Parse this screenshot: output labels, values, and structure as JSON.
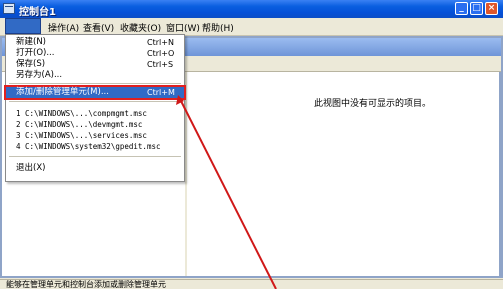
{
  "window": {
    "title": "控制台1",
    "buttons": {
      "minimize": "_",
      "maximize": "□",
      "close": "×"
    }
  },
  "menubar": {
    "items": [
      "操作(A)",
      "查看(V)",
      "收藏夹(O)",
      "窗口(W)",
      "帮助(H)"
    ]
  },
  "file_menu": {
    "group1": [
      {
        "label": "新建(N)",
        "shortcut": "Ctrl+N"
      },
      {
        "label": "打开(O)...",
        "shortcut": "Ctrl+O"
      },
      {
        "label": "保存(S)",
        "shortcut": "Ctrl+S"
      },
      {
        "label": "另存为(A)...",
        "shortcut": ""
      }
    ],
    "add_remove": {
      "label": "添加/删除管理单元(M)...",
      "shortcut": "Ctrl+M"
    },
    "recent": [
      "1 C:\\WINDOWS\\...\\compmgmt.msc",
      "2 C:\\WINDOWS\\...\\devmgmt.msc",
      "3 C:\\WINDOWS\\...\\services.msc",
      "4 C:\\WINDOWS\\system32\\gpedit.msc"
    ],
    "exit": "退出(X)"
  },
  "results": {
    "empty_message": "此视图中没有可显示的项目。"
  },
  "status": {
    "text": "能够在管理单元和控制台添加或删除管理单元"
  },
  "colors": {
    "highlight": "#316ac5",
    "annotation": "#e02020",
    "titlebar": "#0a5fe0"
  }
}
